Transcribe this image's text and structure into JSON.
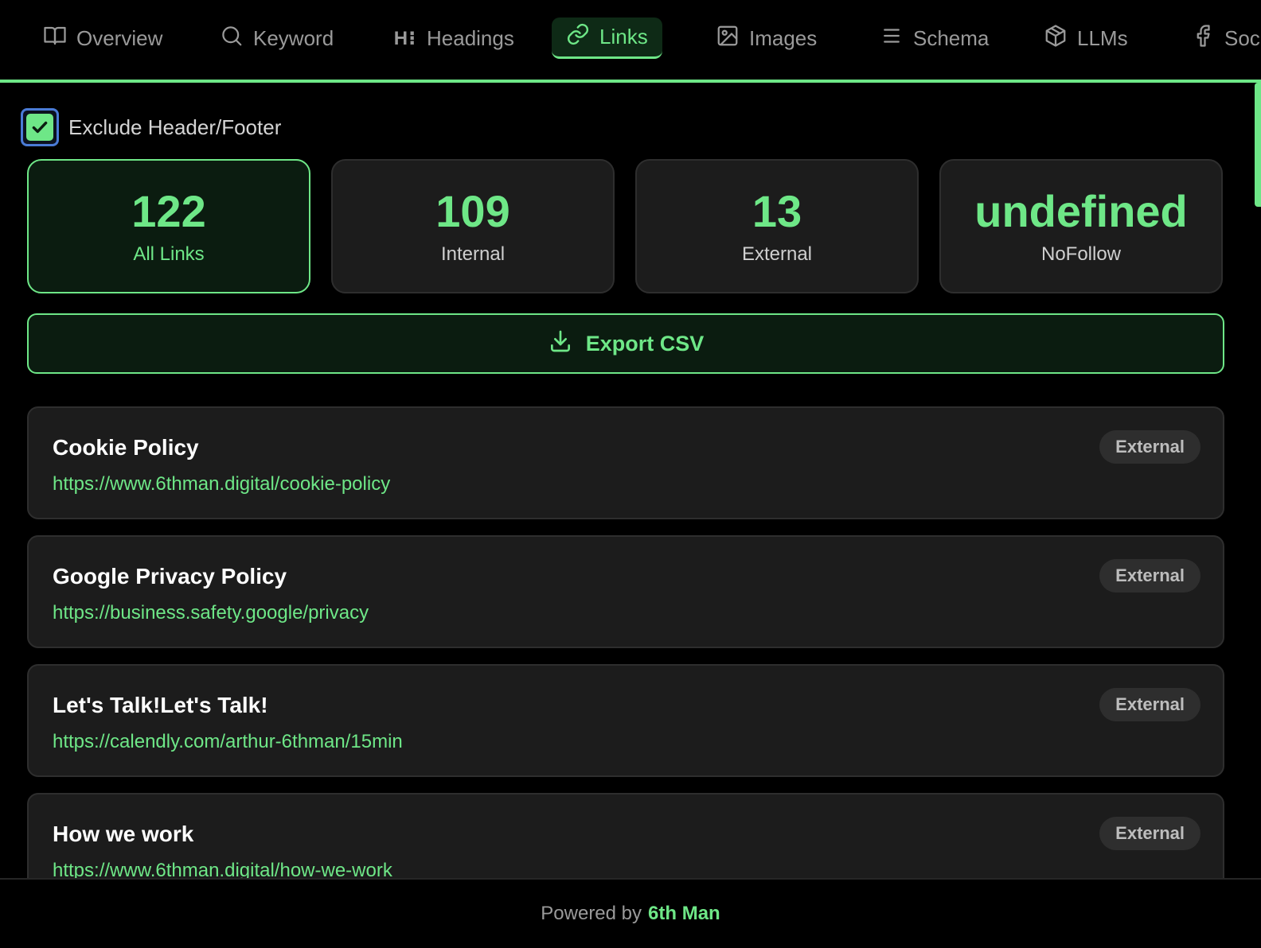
{
  "tabs": [
    {
      "label": "Overview",
      "icon": "book-open-icon",
      "active": false
    },
    {
      "label": "Keyword",
      "icon": "search-icon",
      "active": false
    },
    {
      "label": "Headings",
      "icon": "heading-icon",
      "active": false
    },
    {
      "label": "Links",
      "icon": "link-icon",
      "active": true
    },
    {
      "label": "Images",
      "icon": "image-icon",
      "active": false
    },
    {
      "label": "Schema",
      "icon": "list-icon",
      "active": false
    },
    {
      "label": "LLMs",
      "icon": "cube-icon",
      "active": false
    },
    {
      "label": "Soci",
      "icon": "facebook-icon",
      "active": false
    }
  ],
  "filter": {
    "exclude_label": "Exclude Header/Footer",
    "exclude_checked": true
  },
  "stats": [
    {
      "value": "122",
      "label": "All Links",
      "active": true
    },
    {
      "value": "109",
      "label": "Internal",
      "active": false
    },
    {
      "value": "13",
      "label": "External",
      "active": false
    },
    {
      "value": "undefined",
      "label": "NoFollow",
      "active": false
    }
  ],
  "export": {
    "label": "Export CSV",
    "icon": "download-icon"
  },
  "links": [
    {
      "title": "Cookie Policy",
      "url": "https://www.6thman.digital/cookie-policy",
      "type": "External"
    },
    {
      "title": "Google Privacy Policy",
      "url": "https://business.safety.google/privacy",
      "type": "External"
    },
    {
      "title": "Let's Talk!Let's Talk!",
      "url": "https://calendly.com/arthur-6thman/15min",
      "type": "External"
    },
    {
      "title": "How we work",
      "url": "https://www.6thman.digital/how-we-work",
      "type": "External"
    }
  ],
  "footer": {
    "prefix": "Powered by",
    "brand": "6th Man"
  },
  "colors": {
    "accent": "#6ee787",
    "background": "#000000",
    "card": "#1c1c1c"
  }
}
